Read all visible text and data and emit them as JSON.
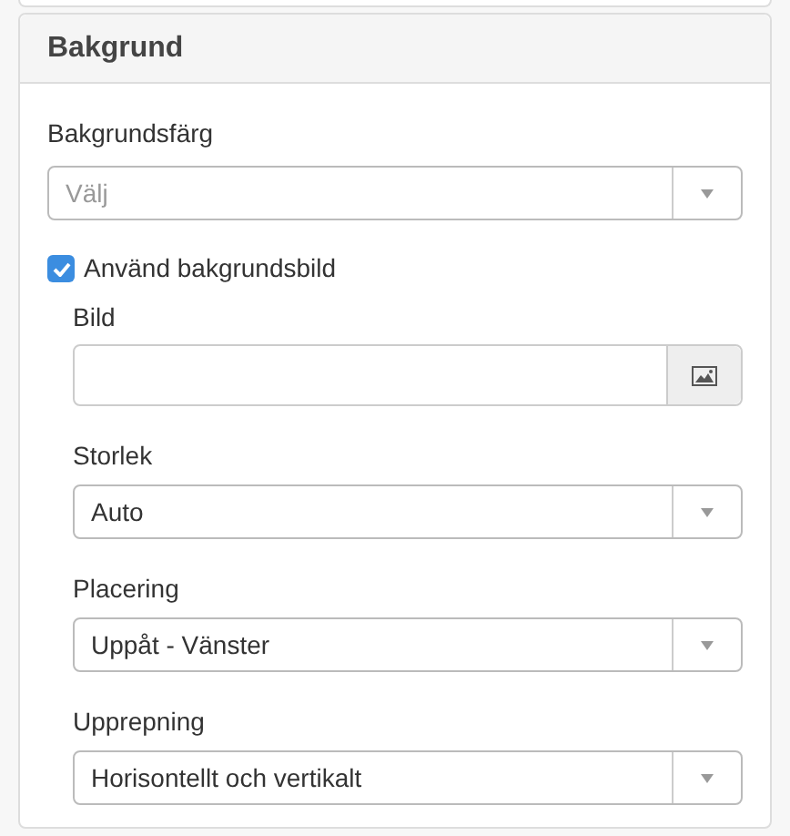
{
  "panel": {
    "title": "Bakgrund"
  },
  "color_field": {
    "label": "Bakgrundsfärg",
    "placeholder": "Välj"
  },
  "use_image": {
    "label": "Använd bakgrundsbild",
    "checked": true
  },
  "image_field": {
    "label": "Bild"
  },
  "selects": [
    {
      "label": "Storlek",
      "value": "Auto"
    },
    {
      "label": "Placering",
      "value": "Uppåt - Vänster"
    },
    {
      "label": "Upprepning",
      "value": "Horisontellt och vertikalt"
    }
  ]
}
